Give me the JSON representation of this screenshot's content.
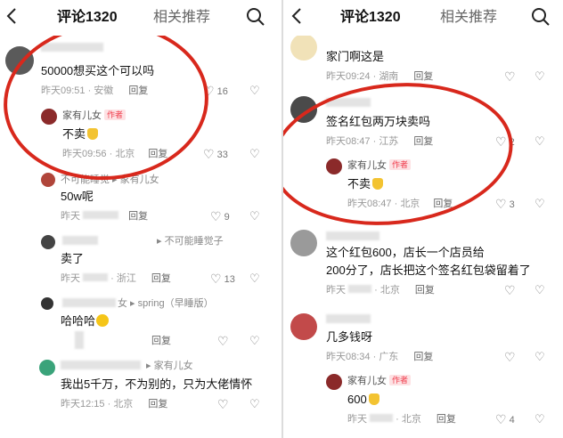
{
  "left_panel": {
    "back_icon": "chevron-left-icon",
    "tab_comments": "评论1320",
    "tab_related": "相关推荐",
    "search_icon": "search-icon",
    "comments": [
      {
        "text": "50000想买这个可以吗",
        "time": "昨天09:51",
        "location": "安徽",
        "reply": "回复",
        "likes": "16"
      },
      {
        "author": "家有儿女",
        "author_tag": "作者",
        "text": "不卖",
        "time": "昨天09:56",
        "location": "北京",
        "reply": "回复",
        "likes": "33"
      },
      {
        "name": "不可能睡觉",
        "reply_to": "家有儿女",
        "text": "50w呢",
        "time": "昨天",
        "reply": "回复",
        "likes": "9"
      },
      {
        "reply_to": "不可能睡觉子",
        "text": "卖了",
        "time": "昨天",
        "location": "浙江",
        "reply": "回复",
        "likes": "13"
      },
      {
        "name": "女",
        "reply_to": "spring（早睡版）",
        "text": "哈哈哈",
        "reply": "回复"
      },
      {
        "reply_to": "家有儿女",
        "text": "我出5千万，不为别的，只为大佬情怀",
        "time": "昨天12:15",
        "location": "北京",
        "reply": "回复"
      }
    ]
  },
  "right_panel": {
    "back_icon": "chevron-left-icon",
    "tab_comments": "评论1320",
    "tab_related": "相关推荐",
    "search_icon": "search-icon",
    "comments": [
      {
        "text": "家门啊这是",
        "time": "昨天09:24",
        "location": "湖南",
        "reply": "回复"
      },
      {
        "text": "签名红包两万块卖吗",
        "time": "昨天08:47",
        "location": "江苏",
        "reply": "回复",
        "likes": "2"
      },
      {
        "author": "家有儿女",
        "author_tag": "作者",
        "text": "不卖",
        "time": "昨天08:47",
        "location": "北京",
        "reply": "回复",
        "likes": "3"
      },
      {
        "text_line1": "这个红包600，店长一个店员给",
        "text_line2": "200分了，店长把这个签名红包袋留着了",
        "time": "昨天",
        "location": "北京",
        "reply": "回复"
      },
      {
        "text": "几多钱呀",
        "time": "昨天08:34",
        "location": "广东",
        "reply": "回复"
      },
      {
        "author": "家有儿女",
        "author_tag": "作者",
        "text": "600",
        "time": "昨天",
        "location": "北京",
        "reply": "回复",
        "likes": "4"
      }
    ]
  },
  "colors": {
    "accent_red": "#d8281c",
    "author_tag_bg": "#fde2e4",
    "author_tag_fg": "#f03a4a"
  }
}
